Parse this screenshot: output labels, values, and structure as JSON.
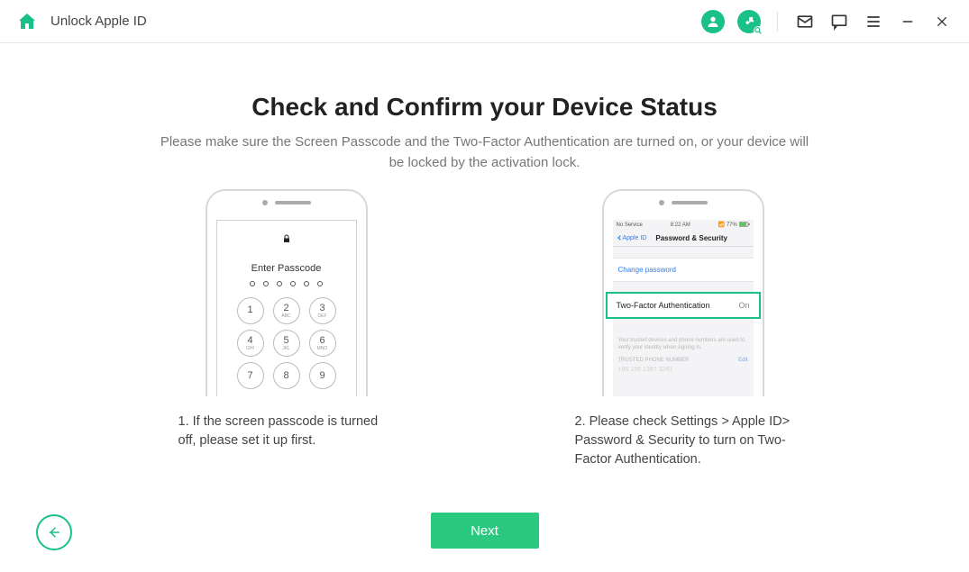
{
  "titlebar": {
    "title": "Unlock Apple ID"
  },
  "main": {
    "heading": "Check and Confirm your Device Status",
    "subtext": "Please make sure the Screen Passcode and the Two-Factor Authentication are turned on, or your device will be locked by the activation lock.",
    "next_label": "Next"
  },
  "passcode": {
    "enter_label": "Enter Passcode",
    "keys": [
      {
        "n": "1",
        "l": ""
      },
      {
        "n": "2",
        "l": "ABC"
      },
      {
        "n": "3",
        "l": "DEF"
      },
      {
        "n": "4",
        "l": "GHI"
      },
      {
        "n": "5",
        "l": "JKL"
      },
      {
        "n": "6",
        "l": "MNO"
      },
      {
        "n": "7",
        "l": ""
      },
      {
        "n": "8",
        "l": ""
      },
      {
        "n": "9",
        "l": ""
      }
    ],
    "caption": "1. If the screen passcode is turned off, please set it up first."
  },
  "settings": {
    "status_carrier": "No Service",
    "status_time": "8:22 AM",
    "status_batt": "77%",
    "back_label": "Apple ID",
    "nav_title": "Password & Security",
    "change_pw_label": "Change password",
    "tfa_label": "Two-Factor Authentication",
    "tfa_value": "On",
    "fine_text": "Your trusted devices and phone numbers are used to verify your identity when signing in.",
    "trusted_label": "TRUSTED PHONE NUMBER",
    "edit_label": "Edit",
    "phone_masked": "+86 158 1387 3241",
    "caption": "2. Please check Settings > Apple ID> Password & Security to turn on Two-Factor Authentication."
  }
}
